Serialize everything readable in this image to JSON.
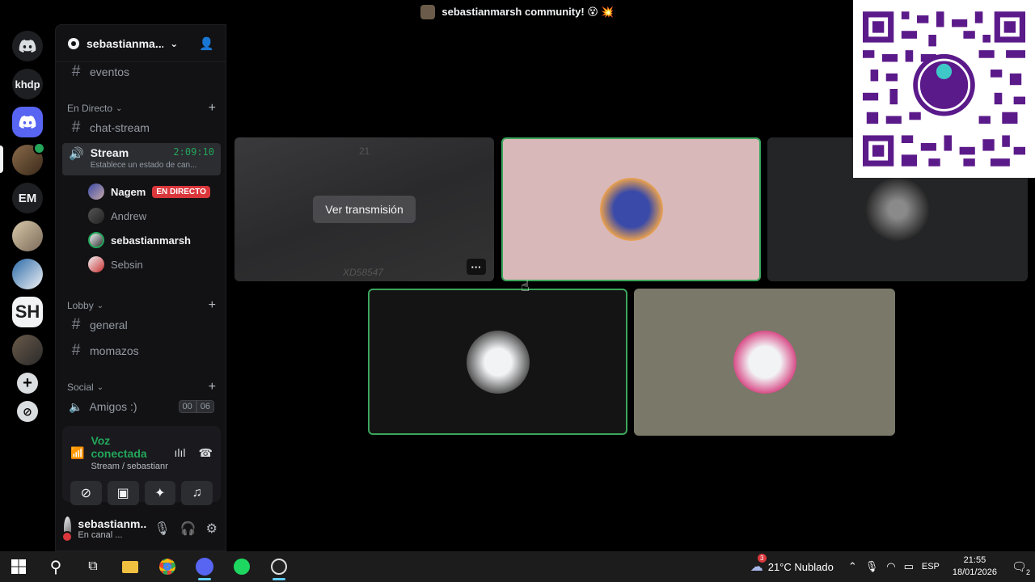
{
  "window": {
    "title": "sebastianmarsh community! 😵 💥"
  },
  "rail": {
    "servers": [
      "khdp",
      "EM",
      "SH"
    ]
  },
  "guild": {
    "name": "sebastianma..."
  },
  "channels": {
    "top_channel": "eventos",
    "cat_live": "En Directo",
    "chat_stream": "chat-stream",
    "stream": {
      "name": "Stream",
      "time": "2:09:10",
      "status": "Establece un estado de can..."
    },
    "voice_users": [
      {
        "name": "Nagem",
        "live": "EN DIRECTO"
      },
      {
        "name": "Andrew"
      },
      {
        "name": "sebastianmarsh"
      },
      {
        "name": "Sebsin"
      }
    ],
    "cat_lobby": "Lobby",
    "general": "general",
    "momazos": "momazos",
    "cat_social": "Social",
    "amigos": "Amigos :)",
    "amigos_counts": [
      "00",
      "06"
    ]
  },
  "voice_panel": {
    "status": "Voz conectada",
    "sub": "Stream / sebastianmarsh..."
  },
  "user": {
    "name": "sebastianm...",
    "status": "En canal ..."
  },
  "stage": {
    "watch_label": "Ver transmisión",
    "more_label": "···",
    "ghost_top": "21",
    "ghost_bottom": "XD58547"
  },
  "taskbar": {
    "weather": "21°C  Nublado",
    "weather_badge": "3",
    "lang": "ESP",
    "time": "21:55",
    "date": "18/01/2026",
    "notif_count": "2"
  },
  "colors": {
    "speaking": "#3ba55c",
    "live": "#da373c",
    "connected": "#23a55a",
    "yape": "#5b1a8a"
  }
}
